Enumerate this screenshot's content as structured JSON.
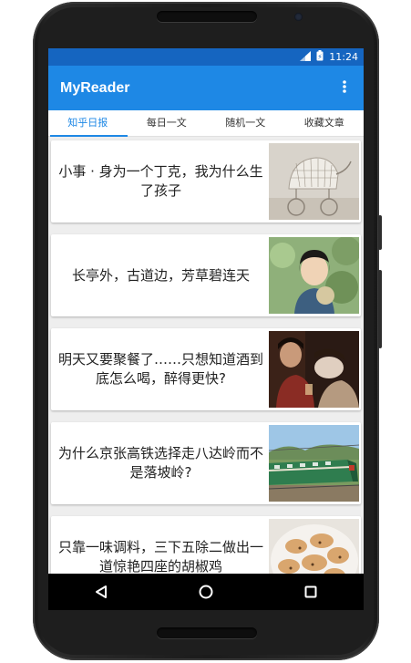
{
  "status_bar": {
    "time": "11:24",
    "signal_icon": "signal-icon",
    "battery_icon": "battery-icon"
  },
  "app": {
    "title": "MyReader",
    "overflow_icon": "more-vert-icon"
  },
  "tabs": [
    {
      "label": "知乎日报",
      "active": true
    },
    {
      "label": "每日一文",
      "active": false
    },
    {
      "label": "随机一文",
      "active": false
    },
    {
      "label": "收藏文章",
      "active": false
    }
  ],
  "articles": [
    {
      "title": "小事 · 身为一个丁克，我为什么生了孩子",
      "thumb": "baby-carriage-image"
    },
    {
      "title": "长亭外，古道边，芳草碧连天",
      "thumb": "girl-portrait-image"
    },
    {
      "title": "明天又要聚餐了……只想知道酒到底怎么喝，醉得更快?",
      "thumb": "drinking-scene-image"
    },
    {
      "title": "为什么京张高铁选择走八达岭而不是落坡岭?",
      "thumb": "green-train-image"
    },
    {
      "title": "只靠一味调料，三下五除二做出一道惊艳四座的胡椒鸡",
      "thumb": "pepper-chicken-image"
    }
  ],
  "nav_bar": {
    "back_icon": "back-icon",
    "home_icon": "home-icon",
    "recents_icon": "recents-icon"
  },
  "colors": {
    "primary": "#1e88e5",
    "primary_dark": "#1565c0",
    "background": "#eeeeee"
  }
}
